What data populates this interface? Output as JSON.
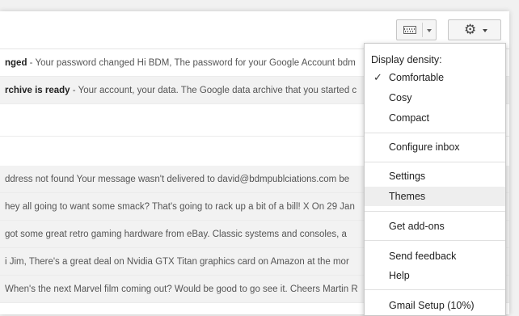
{
  "toolbar": {
    "keyboard_icon": "keyboard-icon",
    "settings_icon": "gear-icon"
  },
  "emails": [
    {
      "subject": "nged",
      "snippet": " - Your password changed Hi BDM, The password for your Google Account bdm",
      "bold": true,
      "read": false
    },
    {
      "subject": "rchive is ready",
      "snippet": " - Your account, your data. The Google data archive that you started c",
      "bold": true,
      "read": true
    },
    {
      "subject": "",
      "snippet": "ddress not found Your message wasn't delivered to david@bdmpublciations.com be",
      "bold": false,
      "read": true
    },
    {
      "subject": "",
      "snippet": "hey all going to want some smack? That's going to rack up a bit of a bill! X On 29 Jan",
      "bold": false,
      "read": true
    },
    {
      "subject": "",
      "snippet": " got some great retro gaming hardware from eBay. Classic systems and consoles, a",
      "bold": false,
      "read": true
    },
    {
      "subject": "",
      "snippet": "i Jim, There's a great deal on Nvidia GTX Titan graphics card on Amazon at the mor",
      "bold": false,
      "read": true
    },
    {
      "subject": "",
      "snippet": "When's the next Marvel film coming out? Would be good to go see it. Cheers Martin R",
      "bold": false,
      "read": true
    }
  ],
  "menu": {
    "density_heading": "Display density:",
    "density_options": [
      "Comfortable",
      "Cosy",
      "Compact"
    ],
    "selected_density": "Comfortable",
    "configure_inbox": "Configure inbox",
    "settings": "Settings",
    "themes": "Themes",
    "get_addons": "Get add-ons",
    "send_feedback": "Send feedback",
    "help": "Help",
    "gmail_setup": "Gmail Setup (10%)"
  }
}
